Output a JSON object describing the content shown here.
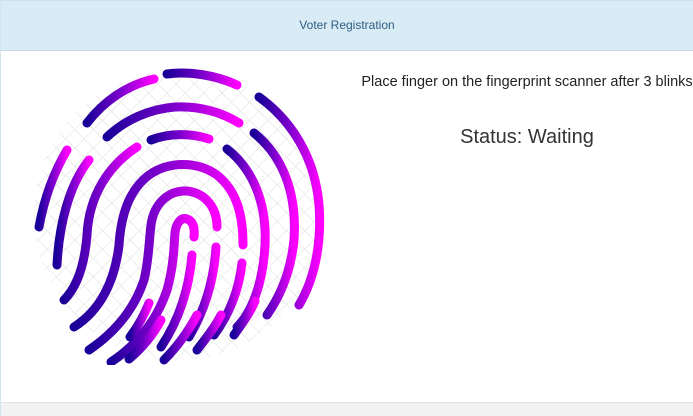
{
  "header": {
    "title": "Voter Registration"
  },
  "scanner": {
    "icon": "fingerprint-icon",
    "gradient_start": "#1a0099",
    "gradient_end": "#ff00ff",
    "instruction": "Place finger on the fingerprint scanner after 3 blinks",
    "status_text": "Status: Waiting"
  },
  "colors": {
    "header_bg": "#d9ebf5",
    "header_text": "#2f5e82"
  }
}
